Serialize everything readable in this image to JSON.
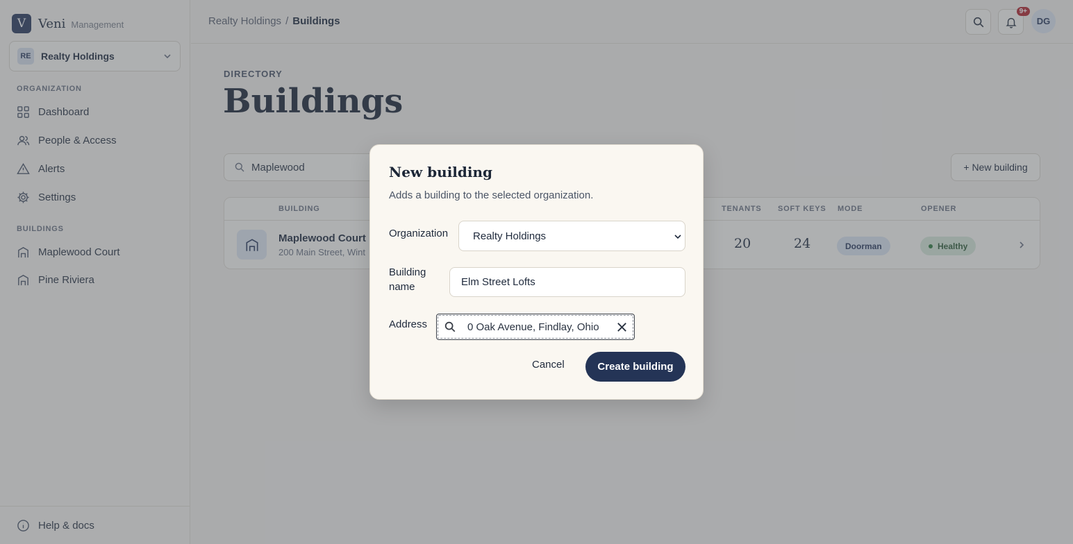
{
  "brand": {
    "logo_letter": "V",
    "name": "Veni",
    "subtitle": "Management"
  },
  "org_switcher": {
    "initials": "RE",
    "name": "Realty Holdings"
  },
  "sidebar": {
    "organization_label": "ORGANIZATION",
    "org_items": [
      {
        "label": "Dashboard",
        "icon": "grid-icon"
      },
      {
        "label": "People & Access",
        "icon": "users-icon"
      },
      {
        "label": "Alerts",
        "icon": "alert-triangle-icon"
      },
      {
        "label": "Settings",
        "icon": "gear-icon"
      }
    ],
    "buildings_label": "BUILDINGS",
    "building_items": [
      {
        "label": "Maplewood Court",
        "icon": "building-icon"
      },
      {
        "label": "Pine Riviera",
        "icon": "building-icon"
      }
    ],
    "help_label": "Help & docs"
  },
  "topbar": {
    "breadcrumb": [
      "Realty Holdings",
      "/",
      "Buildings"
    ],
    "notification_badge": "9+",
    "user_initials": "DG"
  },
  "main": {
    "eyebrow": "DIRECTORY",
    "title": "Buildings",
    "search_value": "Maplewood",
    "new_button": "+ New building",
    "table": {
      "headers": [
        "BUILDING",
        "TENANTS",
        "SOFT KEYS",
        "MODE",
        "OPENER"
      ],
      "rows": [
        {
          "name": "Maplewood Court",
          "address": "200 Main Street, Wint",
          "tenants": "20",
          "soft_keys": "24",
          "mode": "Doorman",
          "opener": "Healthy"
        }
      ]
    }
  },
  "modal": {
    "title": "New building",
    "description": "Adds a building to the selected organization.",
    "organization_label": "Organization",
    "organization_value": "Realty Holdings",
    "building_name_label_1": "Building",
    "building_name_label_2": "name",
    "building_name_value": "Elm Street Lofts",
    "address_label": "Address",
    "address_value": "0 Oak Avenue, Findlay, Ohio",
    "cancel_label": "Cancel",
    "create_label": "Create building"
  },
  "colors": {
    "primary": "#243456",
    "badge": "#b3262d",
    "healthy": "#2f7a3c"
  }
}
